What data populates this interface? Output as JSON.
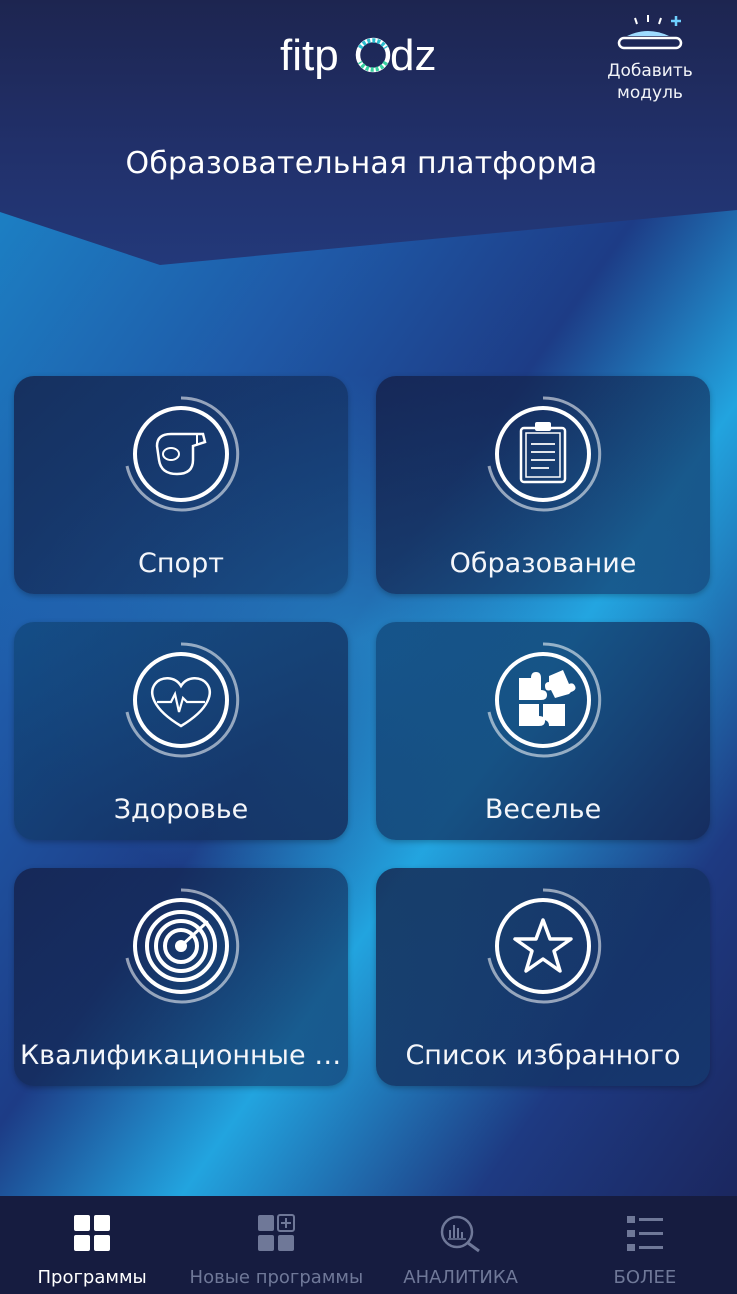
{
  "app": {
    "logo_text": "fitpodz",
    "title": "Образовательная платформа"
  },
  "header": {
    "add_module_label": "Добавить\nмодуль",
    "add_module_icon": "podz-plus-icon"
  },
  "tiles": [
    {
      "label": "Спорт",
      "icon": "whistle-icon"
    },
    {
      "label": "Образование",
      "icon": "clipboard-icon"
    },
    {
      "label": "Здоровье",
      "icon": "heart-pulse-icon"
    },
    {
      "label": "Веселье",
      "icon": "puzzle-icon"
    },
    {
      "label": "Квалификационные т...",
      "icon": "target-icon"
    },
    {
      "label": "Список избранного",
      "icon": "star-icon"
    }
  ],
  "tabbar": {
    "items": [
      {
        "label": "Программы",
        "icon": "grid-icon",
        "active": true
      },
      {
        "label": "Новые программы",
        "icon": "grid-plus-icon",
        "active": false
      },
      {
        "label": "АНАЛИТИКА",
        "icon": "analytics-magnifier-icon",
        "active": false
      },
      {
        "label": "БОЛЕЕ",
        "icon": "list-icon",
        "active": false
      }
    ]
  },
  "colors": {
    "tabbar_bg": "#161c40",
    "active_tab": "#ffffff",
    "inactive_tab": "#6f7898",
    "logo_accent": "#2dbfd0"
  }
}
